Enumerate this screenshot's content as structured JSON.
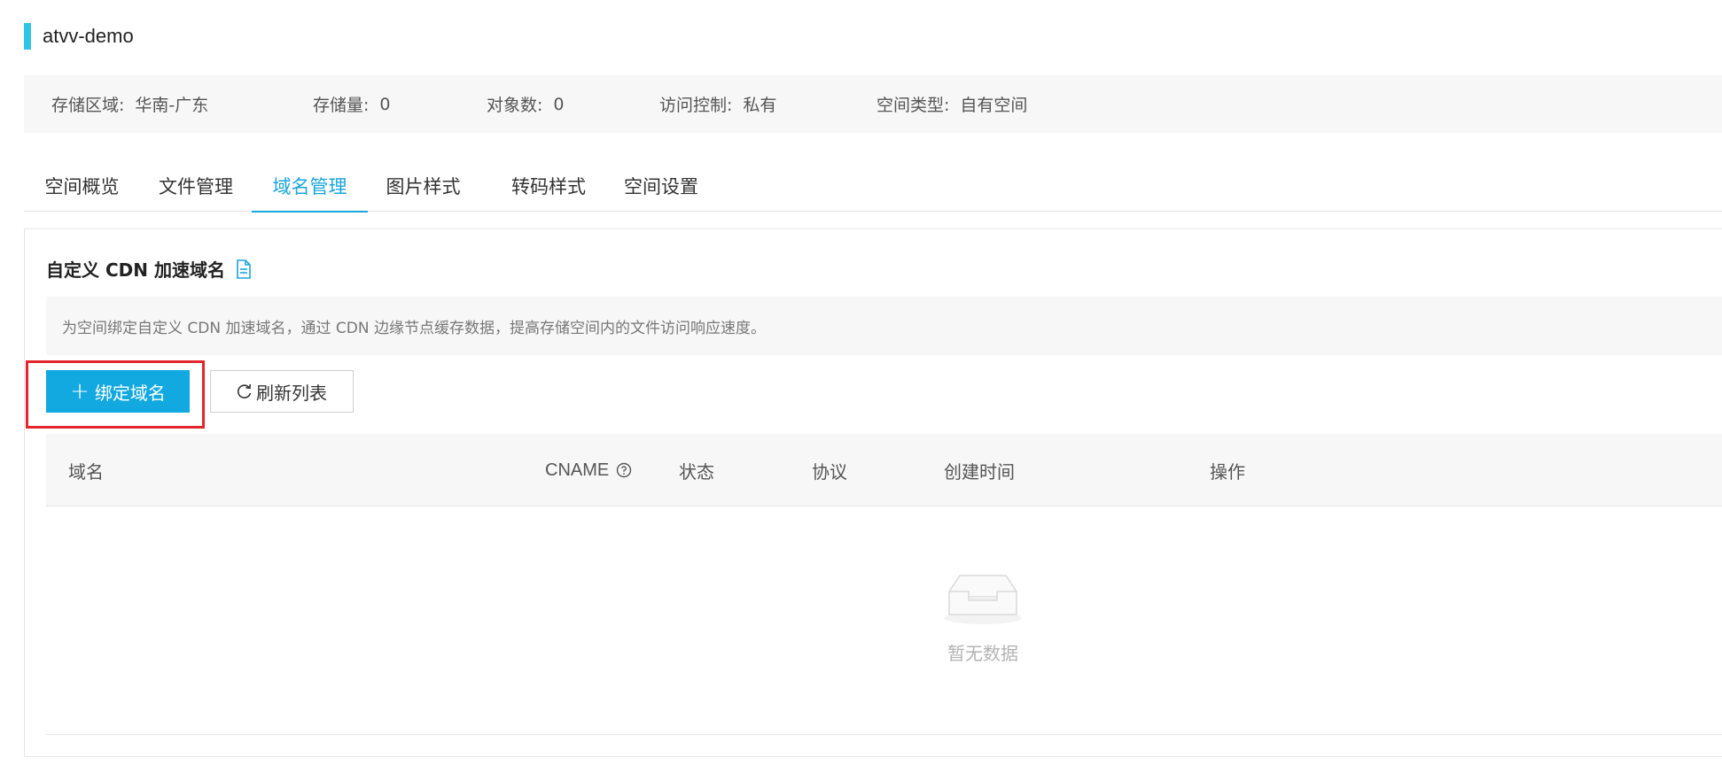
{
  "page": {
    "title": "atvv-demo"
  },
  "info": {
    "region_label": "存储区域:",
    "region_value": "华南-广东",
    "size_label": "存储量:",
    "size_value": "0",
    "objects_label": "对象数:",
    "objects_value": "0",
    "access_label": "访问控制:",
    "access_value": "私有",
    "type_label": "空间类型:",
    "type_value": "自有空间"
  },
  "tabs": [
    {
      "label": "空间概览",
      "active": false
    },
    {
      "label": "文件管理",
      "active": false
    },
    {
      "label": "域名管理",
      "active": true
    },
    {
      "label": "图片样式",
      "active": false
    },
    {
      "label": "转码样式",
      "active": false
    },
    {
      "label": "空间设置",
      "active": false
    }
  ],
  "section": {
    "title": "自定义 CDN 加速域名",
    "doc_icon": "document-icon",
    "notice": "为空间绑定自定义 CDN 加速域名，通过 CDN 边缘节点缓存数据，提高存储空间内的文件访问响应速度。"
  },
  "toolbar": {
    "bind_label": "绑定域名",
    "refresh_label": "刷新列表"
  },
  "table": {
    "columns": {
      "domain": "域名",
      "cname": "CNAME",
      "status": "状态",
      "protocol": "协议",
      "created": "创建时间",
      "action": "操作"
    },
    "rows": [],
    "empty_text": "暂无数据"
  },
  "colors": {
    "accent": "#12a8e0",
    "title_marker": "#2fc4e6",
    "highlight": "#e3262d"
  }
}
